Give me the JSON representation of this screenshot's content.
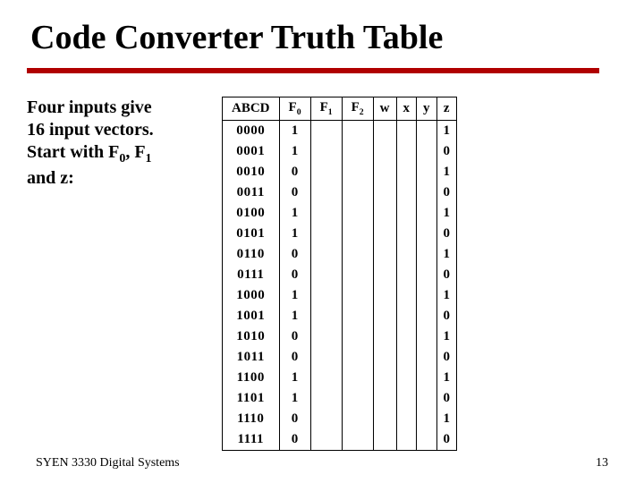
{
  "title": "Code Converter Truth Table",
  "left_text": {
    "line1": "Four inputs give",
    "line2": "16 input vectors.",
    "line3_prefix": "Start with F",
    "line3_sub0": "0",
    "line3_mid": ", F",
    "line3_sub1": "1",
    "line4": "and z:"
  },
  "table": {
    "headers": {
      "abcd": "ABCD",
      "f0_label": "F",
      "f0_sub": "0",
      "f1_label": "F",
      "f1_sub": "1",
      "f2_label": "F",
      "f2_sub": "2",
      "w": "w",
      "x": "x",
      "y": "y",
      "z": "z"
    },
    "rows": [
      {
        "abcd": "0000",
        "f0": "1",
        "f1": "",
        "f2": "",
        "w": "",
        "x": "",
        "y": "",
        "z": "1"
      },
      {
        "abcd": "0001",
        "f0": "1",
        "f1": "",
        "f2": "",
        "w": "",
        "x": "",
        "y": "",
        "z": "0"
      },
      {
        "abcd": "0010",
        "f0": "0",
        "f1": "",
        "f2": "",
        "w": "",
        "x": "",
        "y": "",
        "z": "1"
      },
      {
        "abcd": "0011",
        "f0": "0",
        "f1": "",
        "f2": "",
        "w": "",
        "x": "",
        "y": "",
        "z": "0"
      },
      {
        "abcd": "0100",
        "f0": "1",
        "f1": "",
        "f2": "",
        "w": "",
        "x": "",
        "y": "",
        "z": "1"
      },
      {
        "abcd": "0101",
        "f0": "1",
        "f1": "",
        "f2": "",
        "w": "",
        "x": "",
        "y": "",
        "z": "0"
      },
      {
        "abcd": "0110",
        "f0": "0",
        "f1": "",
        "f2": "",
        "w": "",
        "x": "",
        "y": "",
        "z": "1"
      },
      {
        "abcd": "0111",
        "f0": "0",
        "f1": "",
        "f2": "",
        "w": "",
        "x": "",
        "y": "",
        "z": "0"
      },
      {
        "abcd": "1000",
        "f0": "1",
        "f1": "",
        "f2": "",
        "w": "",
        "x": "",
        "y": "",
        "z": "1"
      },
      {
        "abcd": "1001",
        "f0": "1",
        "f1": "",
        "f2": "",
        "w": "",
        "x": "",
        "y": "",
        "z": "0"
      },
      {
        "abcd": "1010",
        "f0": "0",
        "f1": "",
        "f2": "",
        "w": "",
        "x": "",
        "y": "",
        "z": "1"
      },
      {
        "abcd": "1011",
        "f0": "0",
        "f1": "",
        "f2": "",
        "w": "",
        "x": "",
        "y": "",
        "z": "0"
      },
      {
        "abcd": "1100",
        "f0": "1",
        "f1": "",
        "f2": "",
        "w": "",
        "x": "",
        "y": "",
        "z": "1"
      },
      {
        "abcd": "1101",
        "f0": "1",
        "f1": "",
        "f2": "",
        "w": "",
        "x": "",
        "y": "",
        "z": "0"
      },
      {
        "abcd": "1110",
        "f0": "0",
        "f1": "",
        "f2": "",
        "w": "",
        "x": "",
        "y": "",
        "z": "1"
      },
      {
        "abcd": "1111",
        "f0": "0",
        "f1": "",
        "f2": "",
        "w": "",
        "x": "",
        "y": "",
        "z": "0"
      }
    ]
  },
  "footer": {
    "left": "SYEN 3330  Digital Systems",
    "right": "13"
  }
}
